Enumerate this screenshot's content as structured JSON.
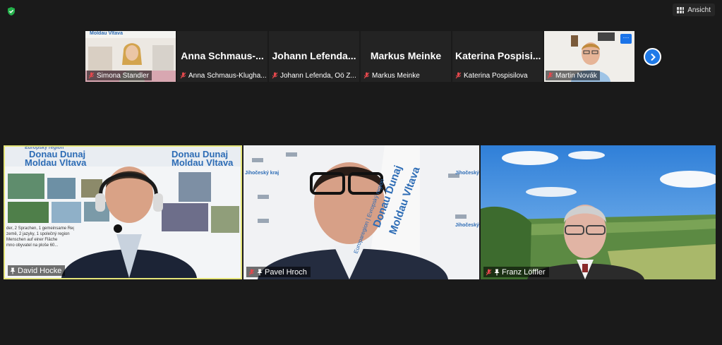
{
  "toolbar": {
    "view_label": "Ansicht"
  },
  "thumbnails": [
    {
      "name": "Simona Standler",
      "big_name": "",
      "logo_text": "Moldau Vltava"
    },
    {
      "name": "Anna Schmaus-Klugha...",
      "big_name": "Anna Schmaus-..."
    },
    {
      "name": "Johann Lefenda, Oö Z...",
      "big_name": "Johann Lefenda..."
    },
    {
      "name": "Markus Meinke",
      "big_name": "Markus Meinke"
    },
    {
      "name": "Katerina Pospisilova",
      "big_name": "Katerina Pospisi..."
    },
    {
      "name": "Martin Novák",
      "big_name": ""
    }
  ],
  "tiles": [
    {
      "name": "David Hocke",
      "banner_line1": "Donau Dunaj",
      "banner_line2": "Moldau Vltava",
      "banner_small": "Europský region",
      "caption_lines": [
        "der, 2 Sprachen, 1 gemeinsame Region",
        "země, 2 jazyky, 1 společný region",
        "Menschen auf einer Fläche",
        "mno obyvatel na ploše 60..."
      ]
    },
    {
      "name": "Pavel Hroch",
      "banner_line1": "Donau Dunaj",
      "banner_line2": "Moldau Vltava",
      "banner_small": "Europaregion | Evropský region",
      "logo_text": "Jihočeský kraj"
    },
    {
      "name": "Franz Löffler"
    }
  ],
  "colors": {
    "accent": "#1f7ae8",
    "active_border": "#e6e67a",
    "muted_red": "#e5484d",
    "background": "#1a1a1a"
  }
}
